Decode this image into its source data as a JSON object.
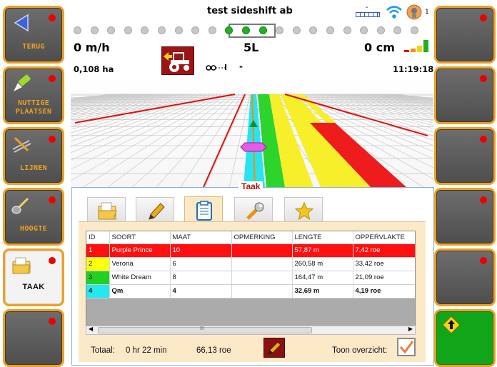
{
  "title": "test sideshift ab",
  "status": {
    "gps_signal": "-",
    "satellites": "1"
  },
  "left_buttons": [
    {
      "label": "TERUG",
      "icon": "back-arrow-icon"
    },
    {
      "label": "NUTTIGE\nPLAATSEN",
      "icon": "pin-marker-icon"
    },
    {
      "label": "LIJNEN",
      "icon": "lines-icon"
    },
    {
      "label": "HOOGTE",
      "icon": "shovel-icon"
    },
    {
      "label": "TAAK",
      "icon": "folder-icon"
    },
    {
      "label": "",
      "icon": ""
    }
  ],
  "right_buttons": [
    "",
    "",
    "",
    "",
    "",
    "up-arrow-icon"
  ],
  "lightbar": {
    "total_dots": 21,
    "active_dots": 3
  },
  "speed": "0 m/h",
  "area": "0,108 ha",
  "offset": "0 cm",
  "line_name": "5L",
  "implement": "-",
  "clock": "11:19:18",
  "panel": {
    "title": "Taak",
    "tabs": [
      "folder-open-icon",
      "pencil-icon",
      "clipboard-icon",
      "wrench-icon",
      "star-icon"
    ],
    "active_tab": 2,
    "columns": [
      "ID",
      "SOORT",
      "MAAT",
      "OPMERKING",
      "LENGTE",
      "OPPERVLAKTE"
    ],
    "rows": [
      {
        "id": "1",
        "soort": "Purple Prince",
        "maat": "10",
        "opmerking": "",
        "lengte": "57,87 m",
        "oppervlakte": "7,42 roe",
        "color": "#ff1010"
      },
      {
        "id": "2",
        "soort": "Verona",
        "maat": "6",
        "opmerking": "",
        "lengte": "260,58 m",
        "oppervlakte": "33,42 roe",
        "color": "#ffff10"
      },
      {
        "id": "3",
        "soort": "White Dream",
        "maat": "8",
        "opmerking": "",
        "lengte": "164,47 m",
        "oppervlakte": "21,09 roe",
        "color": "#22d022"
      },
      {
        "id": "4",
        "soort": "Qm",
        "maat": "4",
        "opmerking": "",
        "lengte": "32,69 m",
        "oppervlakte": "4,19 roe",
        "color": "#22e8f0"
      }
    ],
    "scroll_marker": "III",
    "total_label": "Totaal:",
    "total_time": "0 hr 22 min",
    "total_area": "66,13 roe",
    "overview_label": "Toon overzicht:",
    "overview_checked": true
  },
  "colors": {
    "accent": "#f0a020",
    "alert": "#ee0000",
    "brand_red": "#b01212"
  }
}
